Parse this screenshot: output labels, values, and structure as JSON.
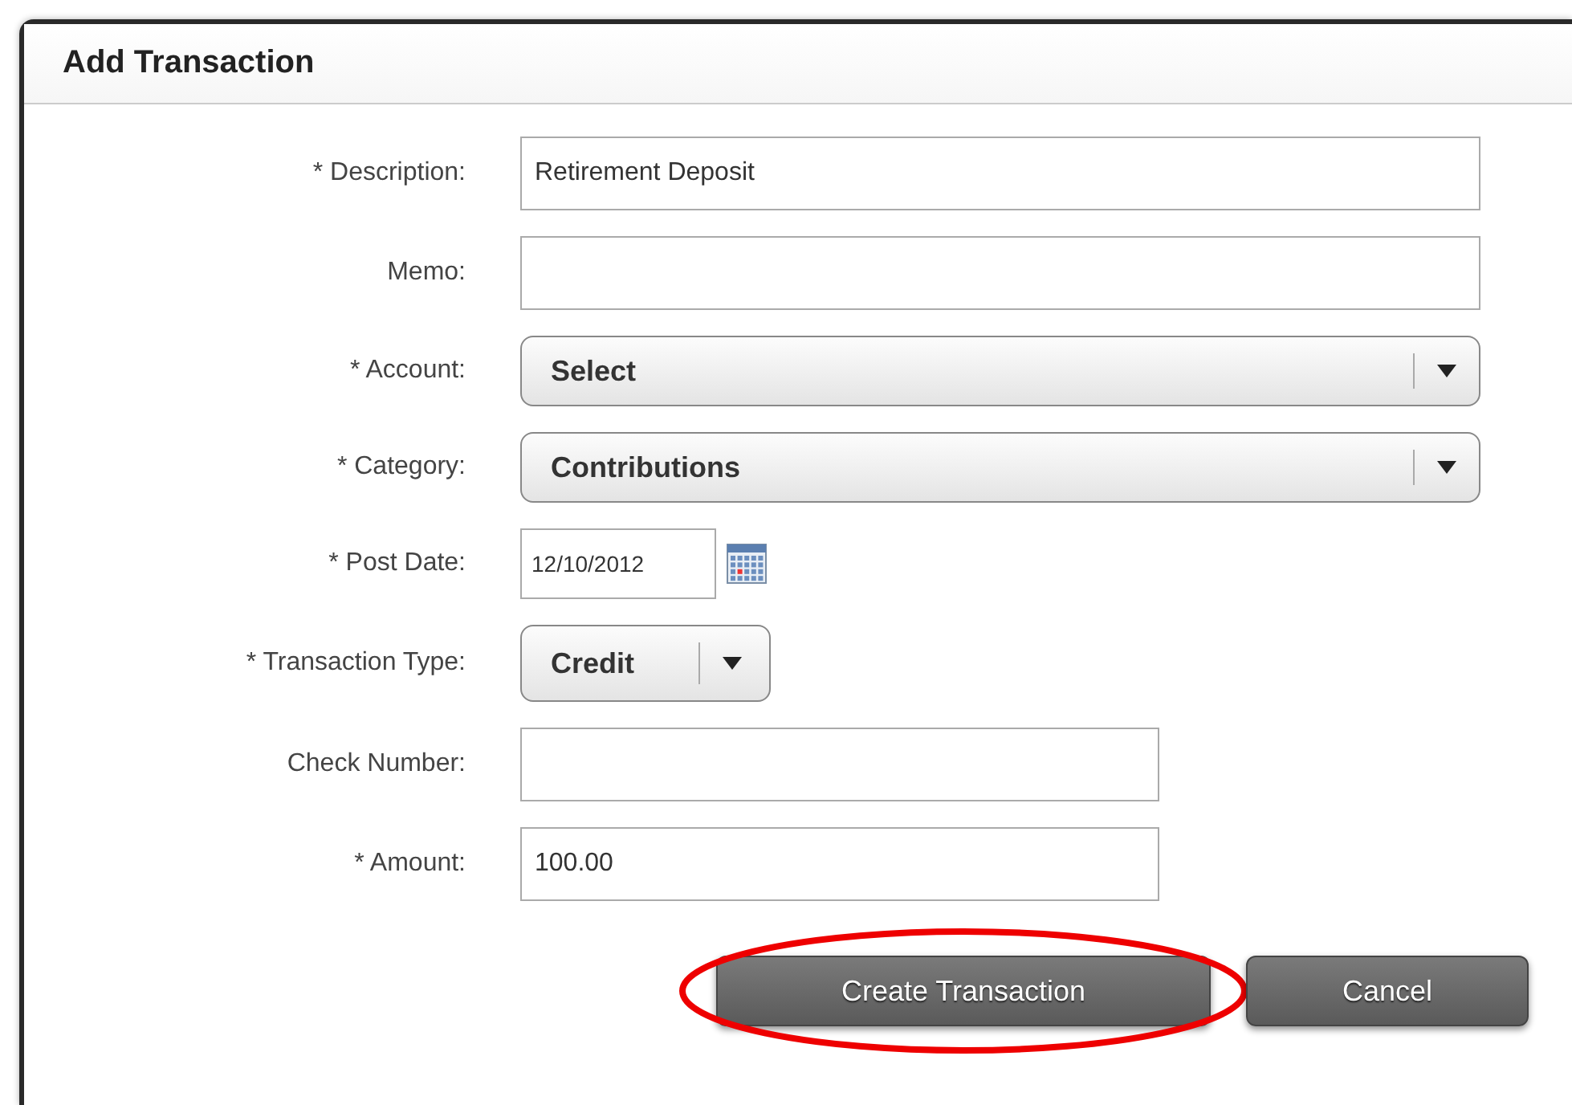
{
  "dialog": {
    "title": "Add Transaction",
    "fields": [
      {
        "kind": "text",
        "label": "* Description:",
        "value": "Retirement Deposit"
      },
      {
        "kind": "text",
        "label": "Memo:"
      },
      {
        "kind": "select",
        "label": "* Account:",
        "value": "Select"
      },
      {
        "kind": "select",
        "label": "* Category:",
        "value": "Contributions"
      },
      {
        "kind": "date",
        "label": "* Post Date:",
        "value": "12/10/2012"
      },
      {
        "kind": "dropdown",
        "label": "* Transaction Type:",
        "value": "Credit"
      },
      {
        "kind": "number",
        "label": "Check Number:"
      },
      {
        "kind": "number",
        "label": "* Amount:",
        "value": "100.00"
      }
    ],
    "buttons": [
      {
        "label": "Create Transaction",
        "highlighted": true
      },
      {
        "label": "Cancel",
        "highlighted": false
      }
    ]
  }
}
